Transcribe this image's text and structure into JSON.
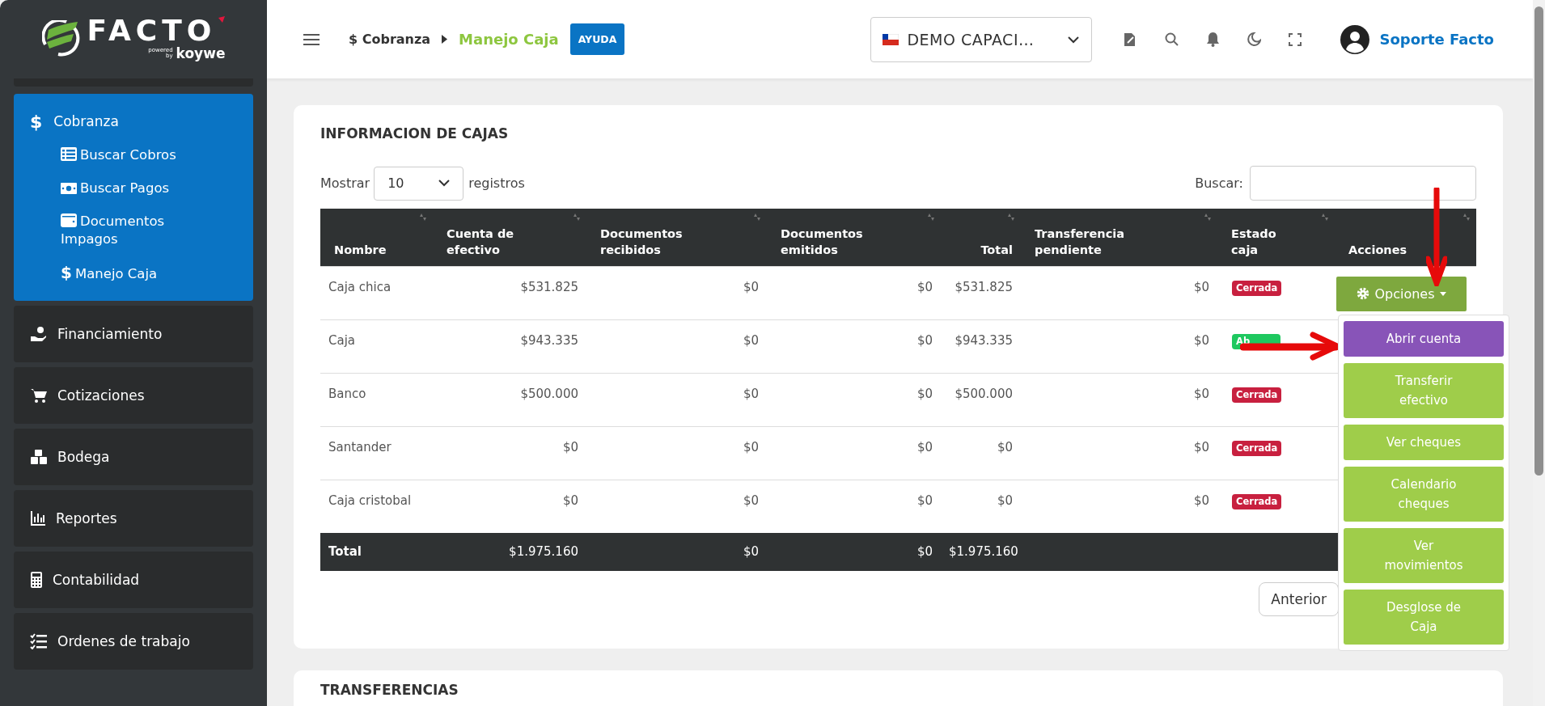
{
  "logo": {
    "wordmark": "FACTO",
    "powered": "powered",
    "by": "by",
    "partner": "koywe"
  },
  "sidebar": {
    "items": [
      {
        "label": "Cobranza",
        "glyph": "$",
        "selected": true,
        "children": [
          {
            "label": "Buscar Cobros"
          },
          {
            "label": "Buscar Pagos"
          },
          {
            "label": "Documentos Impagos"
          },
          {
            "label": "Manejo Caja",
            "glyph": "$"
          }
        ]
      },
      {
        "label": "Financiamiento",
        "selected": false
      },
      {
        "label": "Cotizaciones",
        "selected": false
      },
      {
        "label": "Bodega",
        "selected": false
      },
      {
        "label": "Reportes",
        "selected": false
      },
      {
        "label": "Contabilidad",
        "selected": false
      },
      {
        "label": "Ordenes de trabajo",
        "selected": false
      }
    ]
  },
  "header": {
    "breadcrumb": {
      "parent": "$ Cobranza",
      "current": "Manejo Caja",
      "help": "AYUDA"
    },
    "company": {
      "value": "DEMO CAPACI…"
    },
    "user": {
      "name": "Soporte Facto"
    }
  },
  "cajas": {
    "title": "INFORMACION DE CAJAS",
    "length": {
      "before": "Mostrar",
      "value": "10",
      "after": "registros"
    },
    "search": {
      "label": "Buscar:"
    },
    "columns": [
      "Nombre",
      "Cuenta de efectivo",
      "Documentos recibidos",
      "Documentos emitidos",
      "Total",
      "Transferencia pendiente",
      "Estado caja",
      "Acciones"
    ],
    "rows": [
      {
        "cells": [
          "Caja chica",
          "$531.825",
          "$0",
          "$0",
          "$531.825",
          "$0"
        ],
        "status": {
          "label": "Cerrada",
          "kind": "closed"
        },
        "action": {
          "label": "Opciones",
          "expanded": true,
          "items": [
            {
              "label": "Abrir cuenta",
              "selected": true
            },
            {
              "label": "Transferir efectivo",
              "selected": false
            },
            {
              "label": "Ver cheques",
              "selected": false
            },
            {
              "label": "Calendario cheques",
              "selected": false
            },
            {
              "label": "Ver movimientos",
              "selected": false
            },
            {
              "label": "Desglose de Caja",
              "selected": false
            }
          ]
        }
      },
      {
        "cells": [
          "Caja",
          "$943.335",
          "$0",
          "$0",
          "$943.335",
          "$0"
        ],
        "status": {
          "label": "Ab",
          "kind": "open"
        }
      },
      {
        "cells": [
          "Banco",
          "$500.000",
          "$0",
          "$0",
          "$500.000",
          "$0"
        ],
        "status": {
          "label": "Cerrada",
          "kind": "closed"
        }
      },
      {
        "cells": [
          "Santander",
          "$0",
          "$0",
          "$0",
          "$0",
          "$0"
        ],
        "status": {
          "label": "Cerrada",
          "kind": "closed"
        }
      },
      {
        "cells": [
          "Caja cristobal",
          "$0",
          "$0",
          "$0",
          "$0",
          "$0"
        ],
        "status": {
          "label": "Cerrada",
          "kind": "closed"
        }
      }
    ],
    "total": [
      "Total",
      "$1.975.160",
      "$0",
      "$0",
      "$1.975.160"
    ],
    "pagination": {
      "previous": "Anterior"
    }
  },
  "transferencias": {
    "title": "TRANSFERENCIAS"
  }
}
